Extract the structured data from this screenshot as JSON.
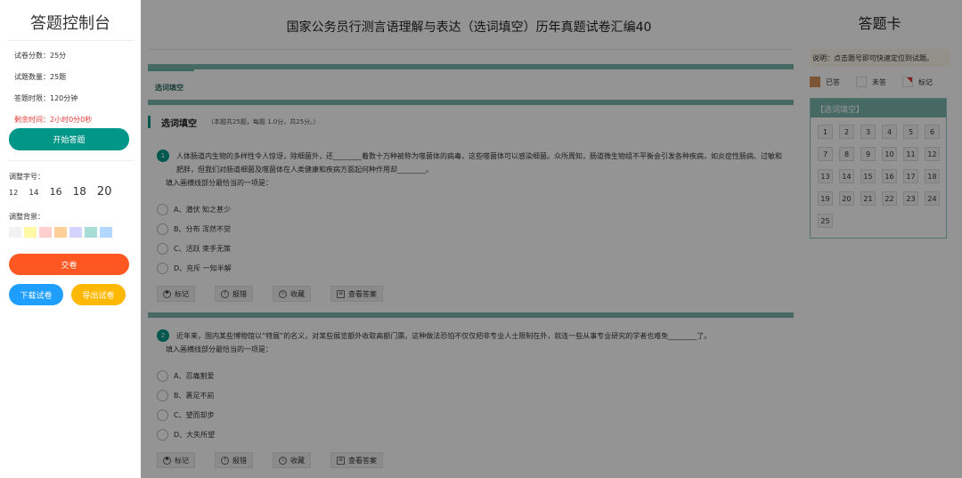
{
  "left": {
    "title": "答题控制台",
    "info": [
      {
        "label": "试卷分数：",
        "value": "25分"
      },
      {
        "label": "试题数量：",
        "value": "25题"
      },
      {
        "label": "答题时限：",
        "value": "120分钟"
      }
    ],
    "remaining_label": "剩余时间：",
    "remaining_value": "2小时0分0秒",
    "start_label": "开始答题",
    "font_label": "调整字号：",
    "font_sizes": [
      "12",
      "14",
      "16",
      "18",
      "20"
    ],
    "bg_label": "调整背景：",
    "bg_colors": [
      "#f2f2f2",
      "#fff9a6",
      "#ffcfcf",
      "#ffcf99",
      "#d4d4ff",
      "#a8dcd6",
      "#b3d8ff"
    ],
    "submit_label": "交卷",
    "download_label": "下载试卷",
    "export_label": "导出试卷"
  },
  "main": {
    "page_title": "国家公务员行测言语理解与表达（选词填空）历年真题试卷汇编40",
    "tab_label": "选词填空",
    "section_title": "选词填空",
    "section_sub": "（本题共25题，每题 1.0分，共25分。）",
    "questions": [
      {
        "num": "1",
        "text": "人体肠道内生物的多样性令人惊讶，除细菌外，还________着数十万种被称为噬菌体的病毒，这些噬菌体可以感染细菌。众所周知，肠道微生物组不平衡会引发各种疾病，如炎症性肠病、过敏和肥胖，但我们对肠道细菌及噬菌体在人类健康和疾病方面起何种作用却________。",
        "sub": "填入画横线部分最恰当的一项是：",
        "options": [
          "A、潜伏  知之甚少",
          "B、分布  浑然不觉",
          "C、活跃  束手无策",
          "D、充斥  一知半解"
        ]
      },
      {
        "num": "2",
        "text": "近年来，国内某些博物馆以“特展”的名义，对某些展览额外收取高额门票。这种做法恐怕不仅仅把非专业人士限制在外，就连一些从事专业研究的学者也难免________了。",
        "sub": "填入画横线部分最恰当的一项是：",
        "options": [
          "A、忍痛割爱",
          "B、裹足不前",
          "C、望而却步",
          "D、大失所望"
        ]
      }
    ],
    "actions": [
      "标记",
      "报错",
      "收藏",
      "查看答案"
    ]
  },
  "right": {
    "title": "答题卡",
    "note": "说明：点击题号即可快速定位到试题。",
    "legend": [
      "已答",
      "未答",
      "标记"
    ],
    "card_head": "【选词填空】",
    "cells": [
      "1",
      "2",
      "3",
      "4",
      "5",
      "6",
      "7",
      "8",
      "9",
      "10",
      "11",
      "12",
      "13",
      "14",
      "15",
      "16",
      "17",
      "18",
      "19",
      "20",
      "21",
      "22",
      "23",
      "24",
      "25"
    ]
  }
}
